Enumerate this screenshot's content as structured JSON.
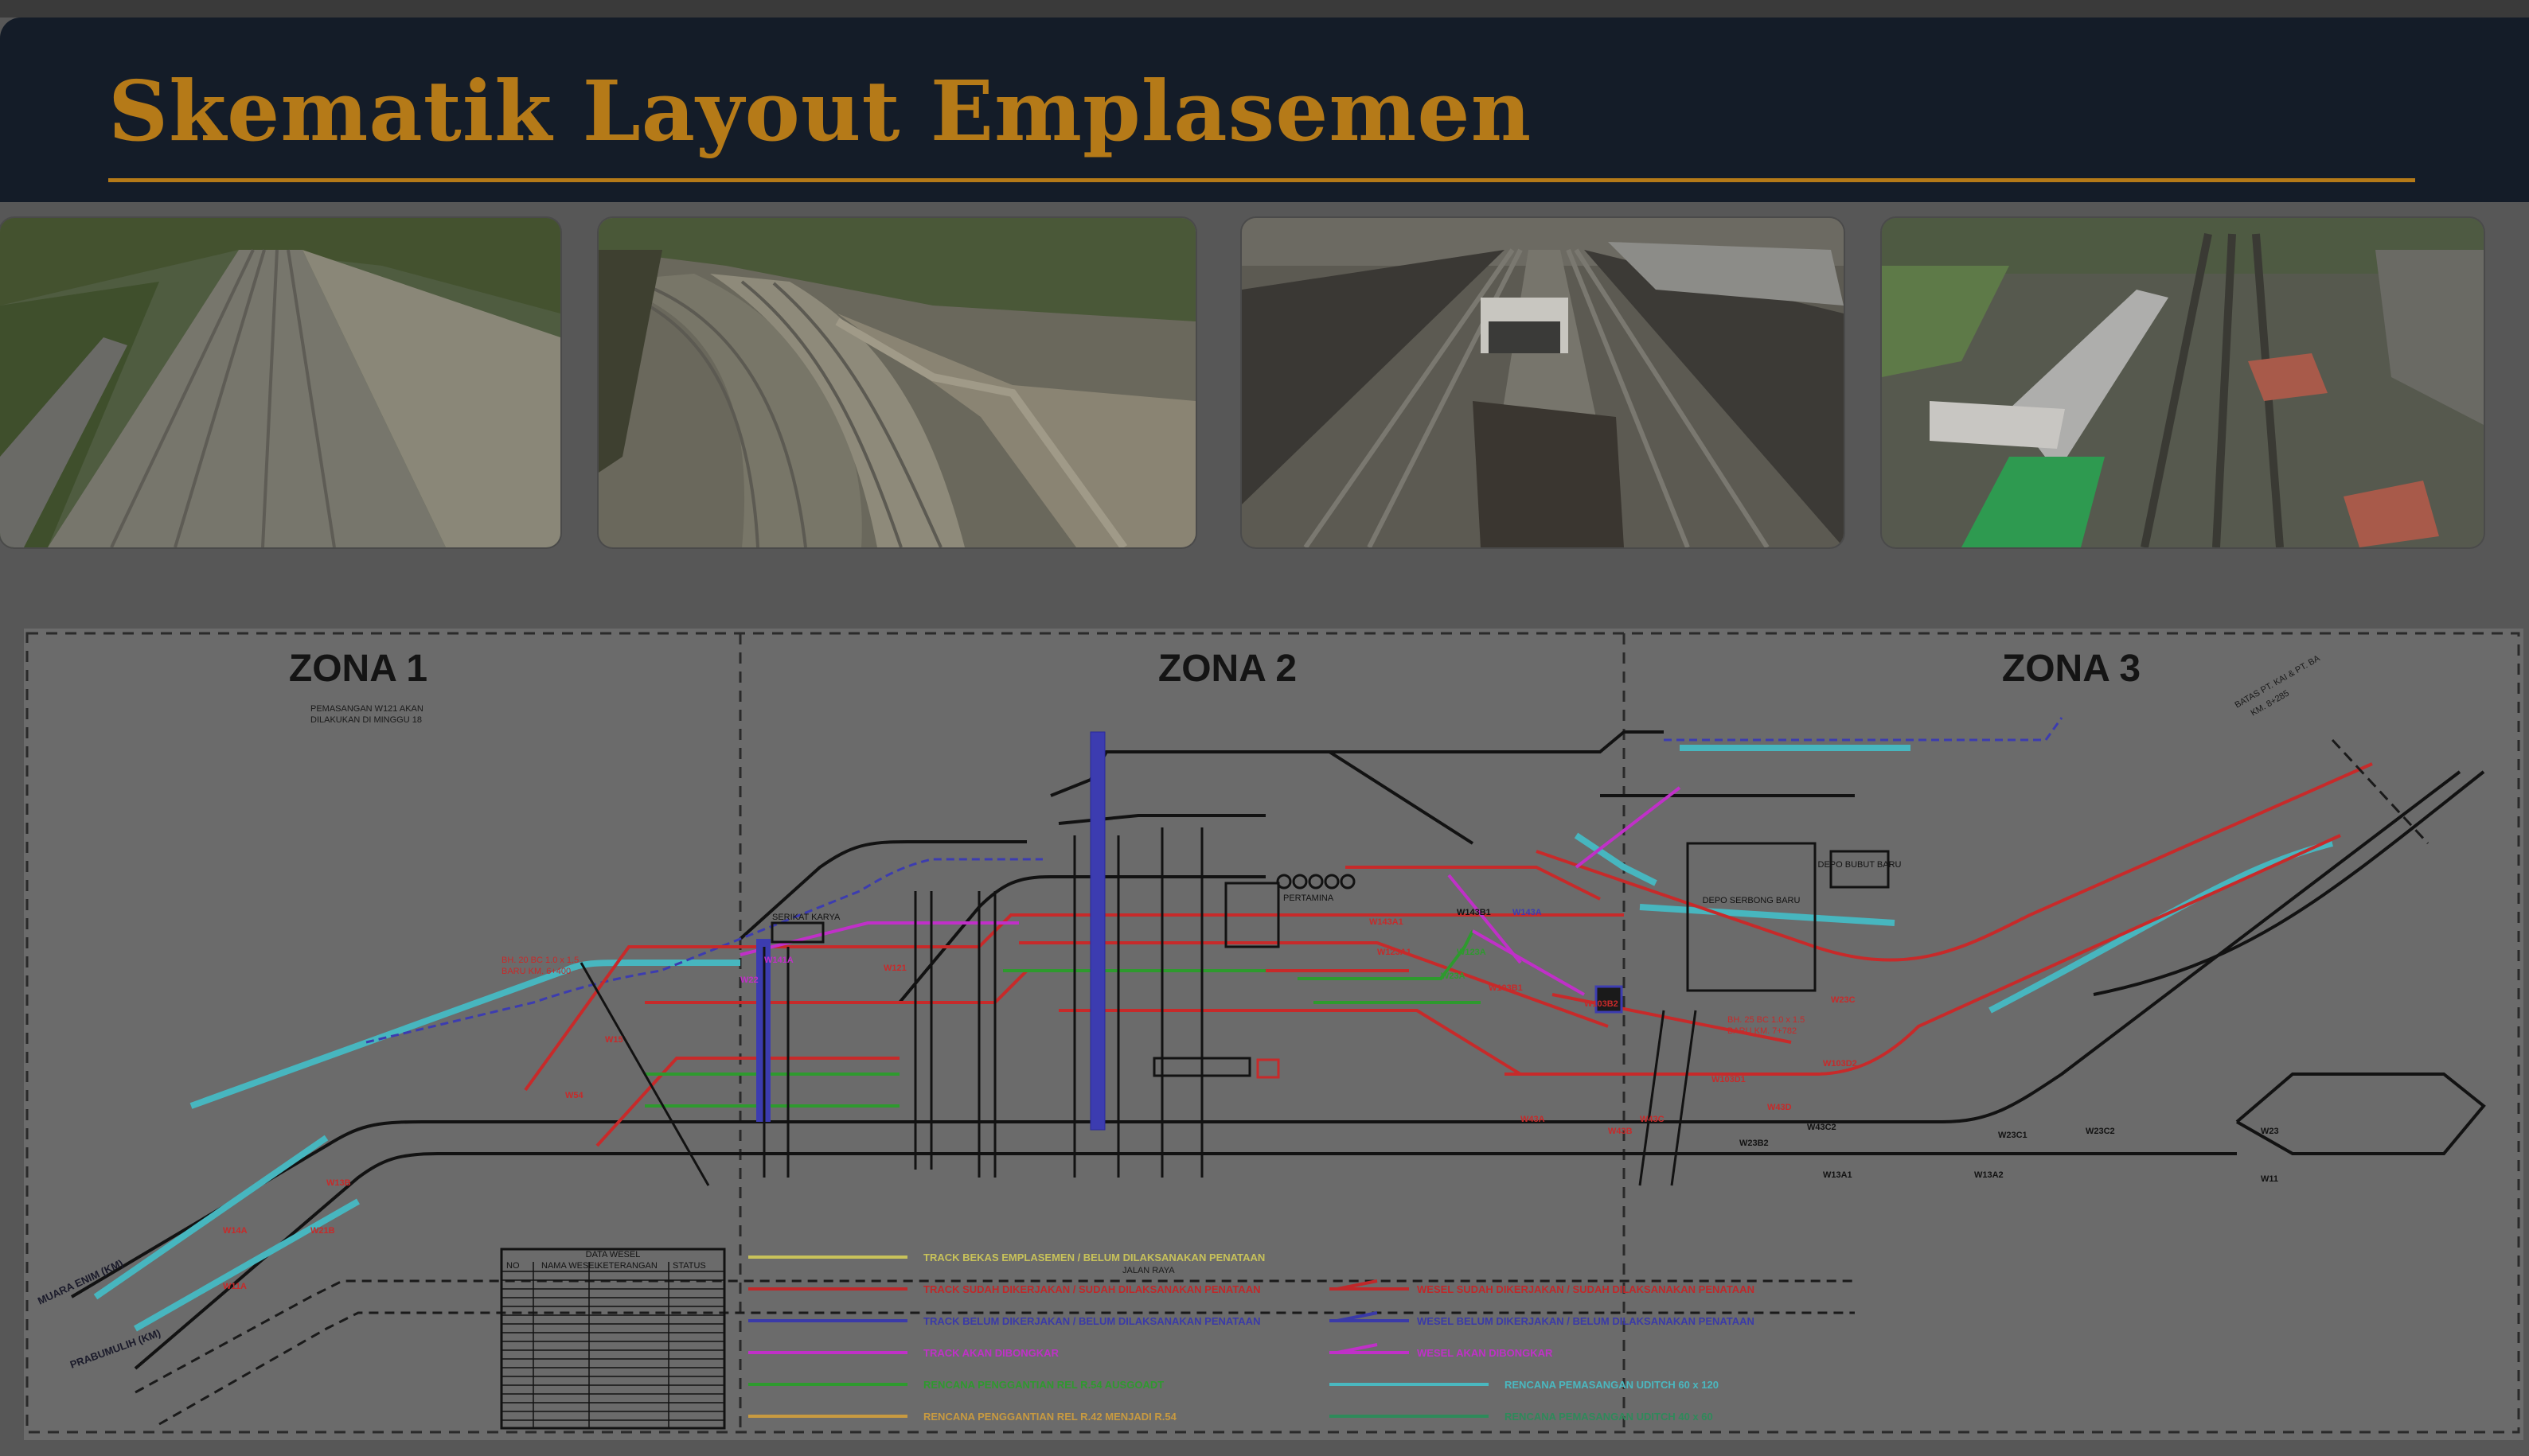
{
  "slide": {
    "title": "Skematik Layout Emplasemen",
    "colors": {
      "title": "#b57a18",
      "header": "#141c28",
      "diagram_bg": "#6b6b6b"
    }
  },
  "photos": [
    {
      "name": "track-cutting-left",
      "palette": [
        "#5c6a4a",
        "#7a7a70",
        "#4a5a38"
      ]
    },
    {
      "name": "track-curve-wall",
      "palette": [
        "#6a6a60",
        "#8a8676",
        "#4c5a3a"
      ]
    },
    {
      "name": "coal-wagons-yard",
      "palette": [
        "#5a5850",
        "#3a3a36",
        "#787870"
      ]
    },
    {
      "name": "depot-building-yard",
      "palette": [
        "#5c6058",
        "#8a8a84",
        "#3e4a3a"
      ]
    }
  ],
  "diagram": {
    "zones": [
      "ZONA 1",
      "ZONA 2",
      "ZONA 3"
    ],
    "notes": {
      "zone1_note_1": "PEMASANGAN W121 AKAN",
      "zone1_note_2": "DILAKUKAN DI MINGGU 18",
      "bh_left_1": "BH. 20 BC 1.0 x 1.5",
      "bh_left_2": "BARU KM. 6+400",
      "bh_right_1": "BH. 25 BC 1.0 x 1.5",
      "bh_right_2": "BARU KM. 7+782",
      "depo": "DEPO SERBONG BARU",
      "depo_small": "DEPO BUBUT BARU",
      "jalan_raya": "JALAN RAYA",
      "pertamina": "PERTAMINA",
      "stadion": "SERIKAT KARYA",
      "right_top_1": "BATAS PT. KAI & PT. BA",
      "right_top_2": "KM. 8+285",
      "left_bottom_1": "MUARA ENIM (KM)",
      "left_bottom_2": "PRABUMULIH (KM)"
    },
    "switch_labels": [
      "W141A",
      "W121",
      "W22",
      "W54",
      "W15",
      "W14A",
      "W13B",
      "W11A",
      "W21B",
      "W143A1",
      "W143B1",
      "W143A",
      "W123A1",
      "W123A",
      "W103B1",
      "W103B2",
      "W23A",
      "W43A",
      "W43C",
      "W43B",
      "W23C",
      "W103D1",
      "W103D2",
      "W43D",
      "W23B2",
      "W43C2",
      "W13A1",
      "W13A2",
      "W23C1",
      "W23C2",
      "W23",
      "W11"
    ],
    "table": {
      "title": "DATA WESEL",
      "headers": [
        "NO",
        "NAMA WESEL",
        "KETERANGAN",
        "STATUS"
      ]
    },
    "legend": [
      {
        "text": "TRACK BEKAS EMPLASEMEN / BELUM DILAKSANAKAN PENATAAN",
        "color": "#c8c25a",
        "kind": "line"
      },
      {
        "text": "TRACK SUDAH DIKERJAKAN / SUDAH DILAKSANAKAN PENATAAN",
        "color": "#c0282a",
        "kind": "line"
      },
      {
        "text": "TRACK BELUM DIKERJAKAN / BELUM DILAKSANAKAN PENATAAN",
        "color": "#3a3aa8",
        "kind": "line"
      },
      {
        "text": "TRACK AKAN DIBONGKAR",
        "color": "#c030c8",
        "kind": "line"
      },
      {
        "text": "RENCANA PENGGANTIAN REL R.54 AUSGOADT",
        "color": "#2e9a2e",
        "kind": "line"
      },
      {
        "text": "RENCANA PENGGANTIAN REL R.42 MENJADI R.54",
        "color": "#c89a40",
        "kind": "line"
      },
      {
        "text": "WESEL SUDAH DIKERJAKAN / SUDAH DILAKSANAKAN PENATAAN",
        "color": "#c0282a",
        "kind": "switch"
      },
      {
        "text": "WESEL BELUM DIKERJAKAN / BELUM DILAKSANAKAN PENATAAN",
        "color": "#3a3aa8",
        "kind": "switch"
      },
      {
        "text": "WESEL AKAN DIBONGKAR",
        "color": "#c030c8",
        "kind": "switch"
      },
      {
        "text": "RENCANA PEMASANGAN UDITCH 60 x 120",
        "color": "#4ab8c0",
        "kind": "line"
      },
      {
        "text": "RENCANA PEMASANGAN UDITCH 40 x 60",
        "color": "#2e8a5a",
        "kind": "line"
      }
    ]
  }
}
